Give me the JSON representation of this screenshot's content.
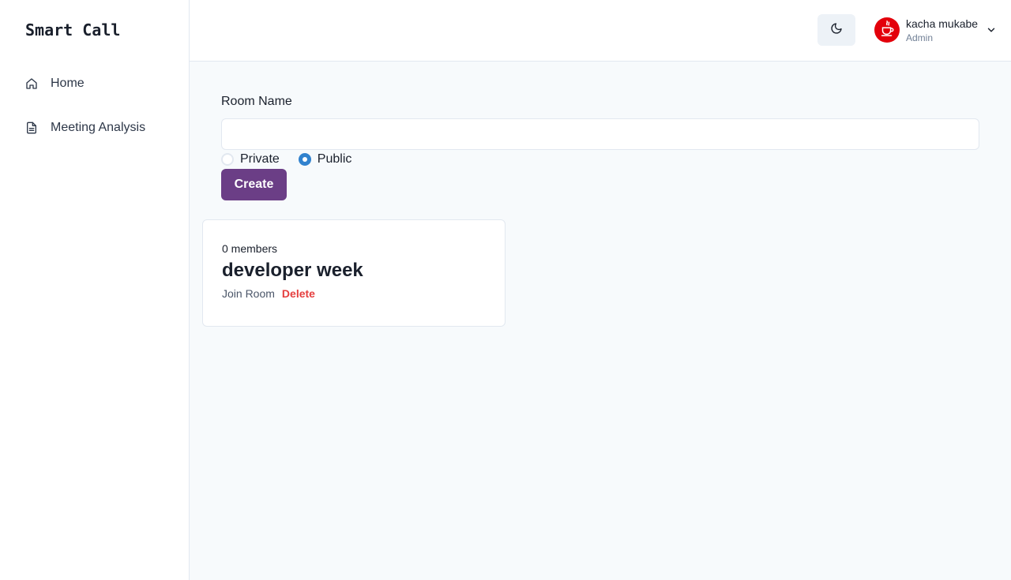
{
  "sidebar": {
    "brand": "Smart Call",
    "items": [
      {
        "label": "Home",
        "icon": "home-icon"
      },
      {
        "label": "Meeting Analysis",
        "icon": "document-icon"
      }
    ]
  },
  "header": {
    "theme_toggle_icon": "moon-icon",
    "user": {
      "name": "kacha mukabe",
      "role": "Admin",
      "avatar_icon": "java-logo-icon",
      "avatar_color": "#e3000b"
    }
  },
  "form": {
    "room_name_label": "Room Name",
    "room_name_value": "",
    "room_name_placeholder": "",
    "visibility_options": [
      {
        "label": "Private",
        "checked": false
      },
      {
        "label": "Public",
        "checked": true
      }
    ],
    "create_label": "Create"
  },
  "rooms": [
    {
      "members": "0 members",
      "name": "developer week",
      "join_label": "Join Room",
      "delete_label": "Delete"
    }
  ],
  "colors": {
    "accent": "#6b3e86",
    "radio_selected": "#3182ce",
    "danger": "#e53e3e"
  }
}
